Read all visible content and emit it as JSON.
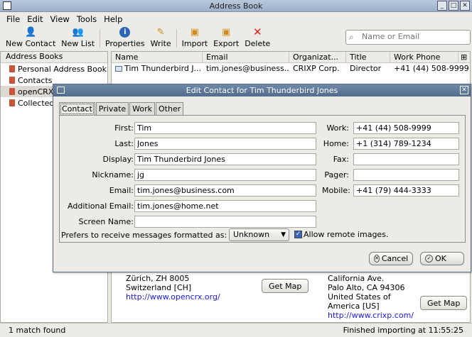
{
  "window": {
    "title": "Address Book"
  },
  "menu": [
    "File",
    "Edit",
    "View",
    "Tools",
    "Help"
  ],
  "toolbar": {
    "new_contact": "New Contact",
    "new_list": "New List",
    "properties": "Properties",
    "write": "Write",
    "import": "Import",
    "export": "Export",
    "delete": "Delete"
  },
  "search": {
    "placeholder": "Name or Email"
  },
  "sidebar": {
    "header": "Address Books",
    "items": [
      "Personal Address Book",
      "Contacts",
      "openCRX",
      "Collected"
    ]
  },
  "list": {
    "columns": [
      "Name",
      "Email",
      "Organizat...",
      "Title",
      "Work Phone"
    ],
    "rows": [
      {
        "name": "Tim Thunderbird J...",
        "email": "tim.jones@business....",
        "org": "CRIXP Corp.",
        "title": "Director",
        "phone": "+41 (44) 508-9999"
      }
    ]
  },
  "detail": {
    "addr1": [
      "Zürich, ZH 8005",
      "Switzerland [CH]"
    ],
    "url1": "http://www.opencrx.org/",
    "addr2": [
      "California Ave.",
      "Palo Alto, CA 94306",
      "United States of",
      "America [US]"
    ],
    "url2": "http://www.crixp.com/",
    "map_label": "Get Map"
  },
  "status": {
    "left": "1 match found",
    "right": "Finished importing at 11:55:25"
  },
  "dialog": {
    "title": "Edit Contact for Tim Thunderbird Jones",
    "tabs": [
      "Contact",
      "Private",
      "Work",
      "Other"
    ],
    "fields": {
      "first_label": "First:",
      "first": "Tim",
      "last_label": "Last:",
      "last": "Jones",
      "display_label": "Display:",
      "display": "Tim Thunderbird Jones",
      "nickname_label": "Nickname:",
      "nickname": "jg",
      "email_label": "Email:",
      "email": "tim.jones@business.com",
      "addemail_label": "Additional Email:",
      "addemail": "tim.jones@home.net",
      "screen_label": "Screen Name:",
      "screen": "",
      "work_label": "Work:",
      "work": "+41 (44) 508-9999",
      "home_label": "Home:",
      "home": "+1 (314) 789-1234",
      "fax_label": "Fax:",
      "fax": "",
      "pager_label": "Pager:",
      "pager": "",
      "mobile_label": "Mobile:",
      "mobile": "+41 (79) 444-3333"
    },
    "pref_label": "Prefers to receive messages formatted as:",
    "format": "Unknown",
    "remote_images": "Allow remote images.",
    "cancel": "Cancel",
    "ok": "OK"
  }
}
